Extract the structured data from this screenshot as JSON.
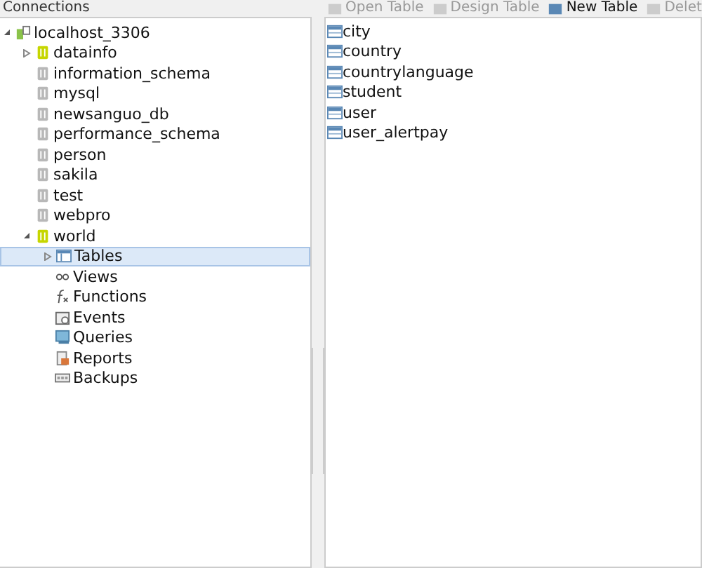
{
  "connections_panel": {
    "title": "Connections"
  },
  "toolbar": {
    "buttons": [
      {
        "label": "Open Table",
        "disabled": true
      },
      {
        "label": "Design Table",
        "disabled": true
      },
      {
        "label": "New Table",
        "disabled": false
      },
      {
        "label": "Delet",
        "disabled": true
      }
    ]
  },
  "tree": {
    "name": "localhost_3306",
    "expanded": true,
    "children": [
      {
        "name": "datainfo",
        "open": true,
        "expanded": false
      },
      {
        "name": "information_schema",
        "open": false
      },
      {
        "name": "mysql",
        "open": false
      },
      {
        "name": "newsanguo_db",
        "open": false
      },
      {
        "name": "performance_schema",
        "open": false
      },
      {
        "name": "person",
        "open": false
      },
      {
        "name": "sakila",
        "open": false
      },
      {
        "name": "test",
        "open": false
      },
      {
        "name": "webpro",
        "open": false
      },
      {
        "name": "world",
        "open": true,
        "expanded": true,
        "children": [
          {
            "name": "Tables",
            "kind": "tables",
            "selected": true,
            "expandable": true
          },
          {
            "name": "Views",
            "kind": "views",
            "selected": false
          },
          {
            "name": "Functions",
            "kind": "functions",
            "selected": false
          },
          {
            "name": "Events",
            "kind": "events",
            "selected": false
          },
          {
            "name": "Queries",
            "kind": "queries",
            "selected": false
          },
          {
            "name": "Reports",
            "kind": "reports",
            "selected": false
          },
          {
            "name": "Backups",
            "kind": "backups",
            "selected": false
          }
        ]
      }
    ]
  },
  "tables": [
    "city",
    "country",
    "countrylanguage",
    "student",
    "user",
    "user_alertpay"
  ]
}
